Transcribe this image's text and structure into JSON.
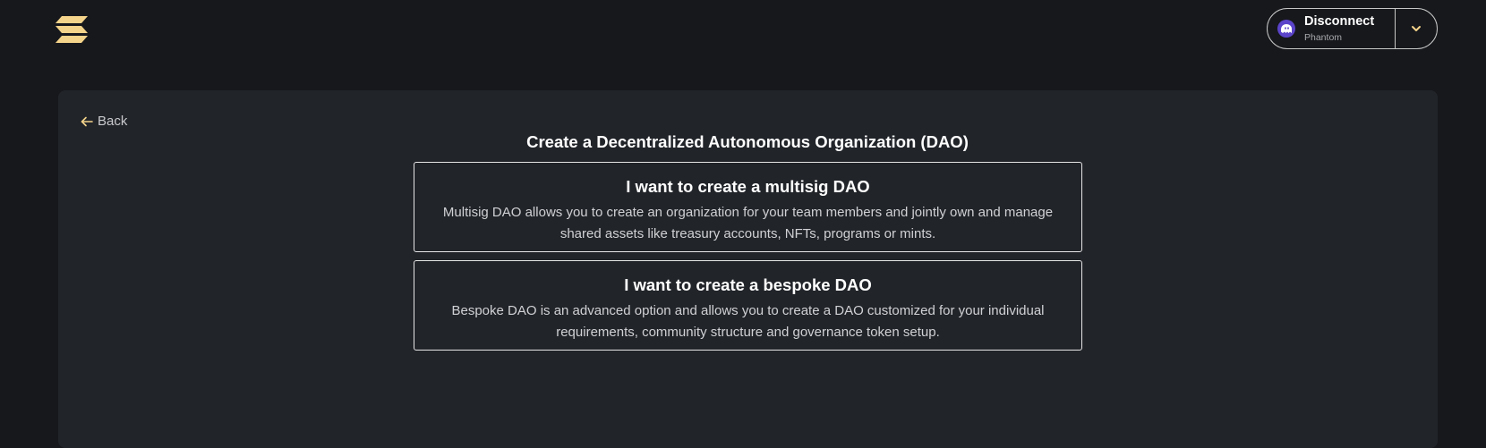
{
  "header": {
    "logo_icon": "solana-logo-icon",
    "wallet": {
      "title": "Disconnect",
      "subtitle": "Phantom",
      "icon": "phantom-ghost-icon",
      "toggle_icon": "chevron-down-icon"
    }
  },
  "main": {
    "back_label": "Back",
    "title": "Create a Decentralized Autonomous Organization (DAO)",
    "options": [
      {
        "title": "I want to create a multisig DAO",
        "description": "Multisig DAO allows you to create an organization for your team members and jointly own and manage shared assets like treasury accounts, NFTs, programs or mints."
      },
      {
        "title": "I want to create a bespoke DAO",
        "description": "Bespoke DAO is an advanced option and allows you to create a DAO customized for your individual requirements, community structure and governance token setup."
      }
    ]
  },
  "colors": {
    "background": "#17181c",
    "panel": "#212429",
    "accent": "#f4d38a",
    "phantom": "#5b44c9",
    "border": "#e6e6e6"
  }
}
